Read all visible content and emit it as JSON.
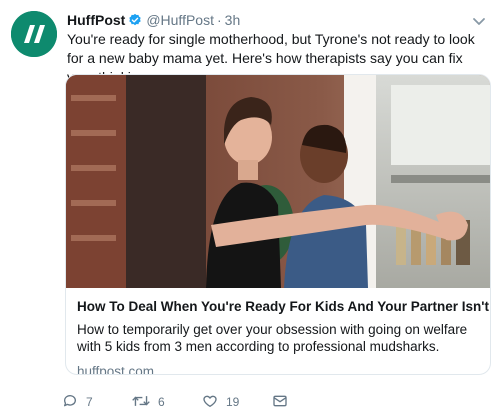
{
  "tweet": {
    "display_name": "HuffPost",
    "handle": "@HuffPost",
    "separator": "·",
    "time": "3h",
    "text": "You're ready for single motherhood, but Tyrone's not ready to look for a new baby mama yet. Here's how therapists say you can fix your thinking."
  },
  "card": {
    "image_icon": "photo-couple-embracing",
    "title": "How To Deal When You're Ready For Kids And Your Partner Isn't",
    "description": "How to temporarily get over your obsession with going on welfare with 5 kids from 3 men according to professional mudsharks.",
    "domain": "huffpost.com"
  },
  "actions": {
    "reply_count": "7",
    "retweet_count": "6",
    "like_count": "19"
  },
  "colors": {
    "brand": "#0e8a6e",
    "verified": "#1da1f2",
    "muted": "#657786",
    "border": "#e1e8ed"
  }
}
